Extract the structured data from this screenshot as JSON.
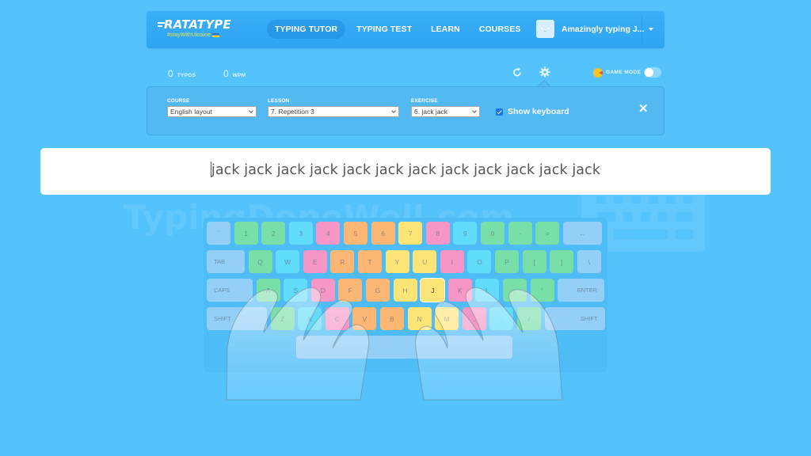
{
  "header": {
    "logo": {
      "name": "RATATYPE",
      "tagline": "#stayWithUkraine"
    },
    "nav": [
      {
        "label": "TYPING TUTOR",
        "active": true
      },
      {
        "label": "TYPING TEST",
        "active": false
      },
      {
        "label": "LEARN",
        "active": false
      },
      {
        "label": "COURSES",
        "active": false
      }
    ],
    "user": {
      "name": "Amazingly typing J...",
      "avatar_icon": "robot-face-icon",
      "menu_icon": "caret-down-icon"
    }
  },
  "stats": {
    "typos": {
      "value": "0",
      "label": "TYPOS"
    },
    "wpm": {
      "value": "0",
      "label": "WPM"
    }
  },
  "tools": {
    "restart_icon": "restart-icon",
    "settings_icon": "gear-icon",
    "game_mode": {
      "label": "GAME MODE",
      "enabled": false,
      "icon": "pacman-icon"
    }
  },
  "settings": {
    "course": {
      "label": "COURSE",
      "value": "English layout"
    },
    "lesson": {
      "label": "LESSON",
      "value": "7. Repetition 3"
    },
    "exercise": {
      "label": "EXERCISE",
      "value": "6. jack jack"
    },
    "show_keyboard": {
      "label": "Show keyboard",
      "checked": true
    },
    "close_icon": "close-icon"
  },
  "exercise_text": "jack jack jack jack jack jack jack jack jack jack jack jack",
  "watermark": "TypingDoneWell.com",
  "keyboard": {
    "active_key": "J",
    "rows": [
      [
        {
          "label": "`",
          "color": "gray"
        },
        {
          "label": "1",
          "color": "green"
        },
        {
          "label": "2",
          "color": "green"
        },
        {
          "label": "3",
          "color": "cyan"
        },
        {
          "label": "4",
          "color": "pink"
        },
        {
          "label": "5",
          "color": "orange"
        },
        {
          "label": "6",
          "color": "orange"
        },
        {
          "label": "7",
          "color": "yellow"
        },
        {
          "label": "8",
          "color": "pink"
        },
        {
          "label": "9",
          "color": "cyan"
        },
        {
          "label": "0",
          "color": "green"
        },
        {
          "label": "-",
          "color": "green"
        },
        {
          "label": "=",
          "color": "green"
        },
        {
          "label": "←",
          "color": "gray"
        }
      ],
      [
        {
          "label": "TAB",
          "color": "gray"
        },
        {
          "label": "Q",
          "color": "green"
        },
        {
          "label": "W",
          "color": "cyan"
        },
        {
          "label": "E",
          "color": "pink"
        },
        {
          "label": "R",
          "color": "orange"
        },
        {
          "label": "T",
          "color": "orange"
        },
        {
          "label": "Y",
          "color": "yellow"
        },
        {
          "label": "U",
          "color": "yellow"
        },
        {
          "label": "I",
          "color": "pink"
        },
        {
          "label": "O",
          "color": "cyan"
        },
        {
          "label": "P",
          "color": "green"
        },
        {
          "label": "[",
          "color": "green"
        },
        {
          "label": "]",
          "color": "green"
        },
        {
          "label": "\\",
          "color": "gray"
        }
      ],
      [
        {
          "label": "CAPS",
          "color": "gray"
        },
        {
          "label": "A",
          "color": "green"
        },
        {
          "label": "S",
          "color": "cyan"
        },
        {
          "label": "D",
          "color": "pink"
        },
        {
          "label": "F",
          "color": "orange"
        },
        {
          "label": "G",
          "color": "orange"
        },
        {
          "label": "H",
          "color": "yellow"
        },
        {
          "label": "J",
          "color": "yellow"
        },
        {
          "label": "K",
          "color": "pink"
        },
        {
          "label": "L",
          "color": "cyan"
        },
        {
          "label": ";",
          "color": "green"
        },
        {
          "label": "'",
          "color": "green"
        },
        {
          "label": "ENTER",
          "color": "gray"
        }
      ],
      [
        {
          "label": "SHIFT",
          "color": "gray"
        },
        {
          "label": "Z",
          "color": "green"
        },
        {
          "label": "X",
          "color": "cyan"
        },
        {
          "label": "C",
          "color": "pink"
        },
        {
          "label": "V",
          "color": "orange"
        },
        {
          "label": "B",
          "color": "orange"
        },
        {
          "label": "N",
          "color": "yellow"
        },
        {
          "label": "M",
          "color": "yellow"
        },
        {
          "label": ",",
          "color": "pink"
        },
        {
          "label": ".",
          "color": "cyan"
        },
        {
          "label": "/",
          "color": "green"
        },
        {
          "label": "SHIFT",
          "color": "gray"
        }
      ],
      [
        {
          "label": "",
          "color": "space"
        }
      ]
    ]
  },
  "colors": {
    "background": "#54c3fc",
    "header": "#2fa4f2",
    "panel": "#52b9f2",
    "green": "#79dfa9",
    "cyan": "#62dcfb",
    "pink": "#f596c6",
    "orange": "#fdb774",
    "yellow": "#fde477",
    "gray": "#94cff7"
  }
}
